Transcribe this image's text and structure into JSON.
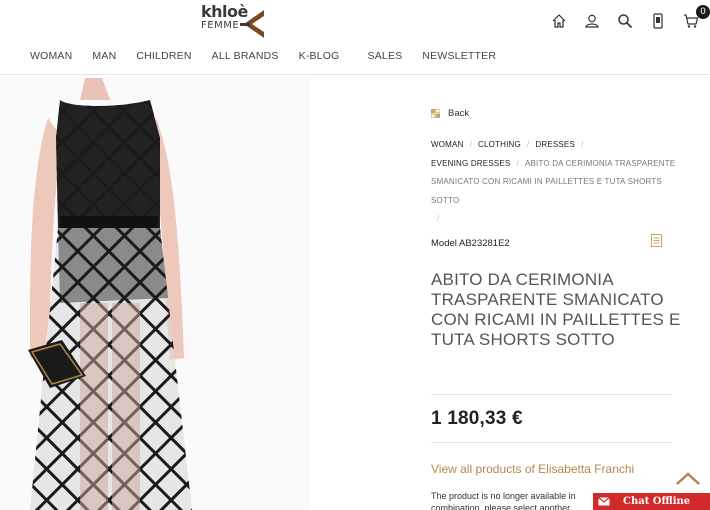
{
  "brand": {
    "logo_main": "khloè",
    "logo_sub": "FEMME"
  },
  "header": {
    "icons": [
      "home-icon",
      "user-icon",
      "search-icon",
      "phone-icon",
      "cart-icon"
    ],
    "cart_count": "0"
  },
  "nav": {
    "items": [
      "WOMAN",
      "MAN",
      "CHILDREN",
      "ALL BRANDS",
      "K-BLOG",
      "SALES",
      "NEWSLETTER"
    ]
  },
  "product": {
    "back_label": "Back",
    "breadcrumb": {
      "items": [
        "WOMAN",
        "CLOTHING",
        "DRESSES",
        "EVENING DRESSES"
      ],
      "current": "ABITO DA CERIMONIA TRASPARENTE SMANICATO CON RICAMI IN PAILLETTES E TUTA SHORTS SOTTO"
    },
    "model": "Model AB23281E2",
    "title": "ABITO DA CERIMONIA TRASPARENTE SMANICATO CON RICAMI IN PAILLETTES E TUTA SHORTS SOTTO",
    "price": "1 180,33 €",
    "view_all": "View all products of Elisabetta Franchi",
    "notice_line1": "The product is no longer available in",
    "notice_line2": "combination, please select another"
  },
  "chat": {
    "label": "Chat Offline"
  },
  "colors": {
    "accent": "#b08a49",
    "logo_brown": "#7a4a25",
    "chat_red": "#d12a2a",
    "text_dark": "#222222"
  }
}
